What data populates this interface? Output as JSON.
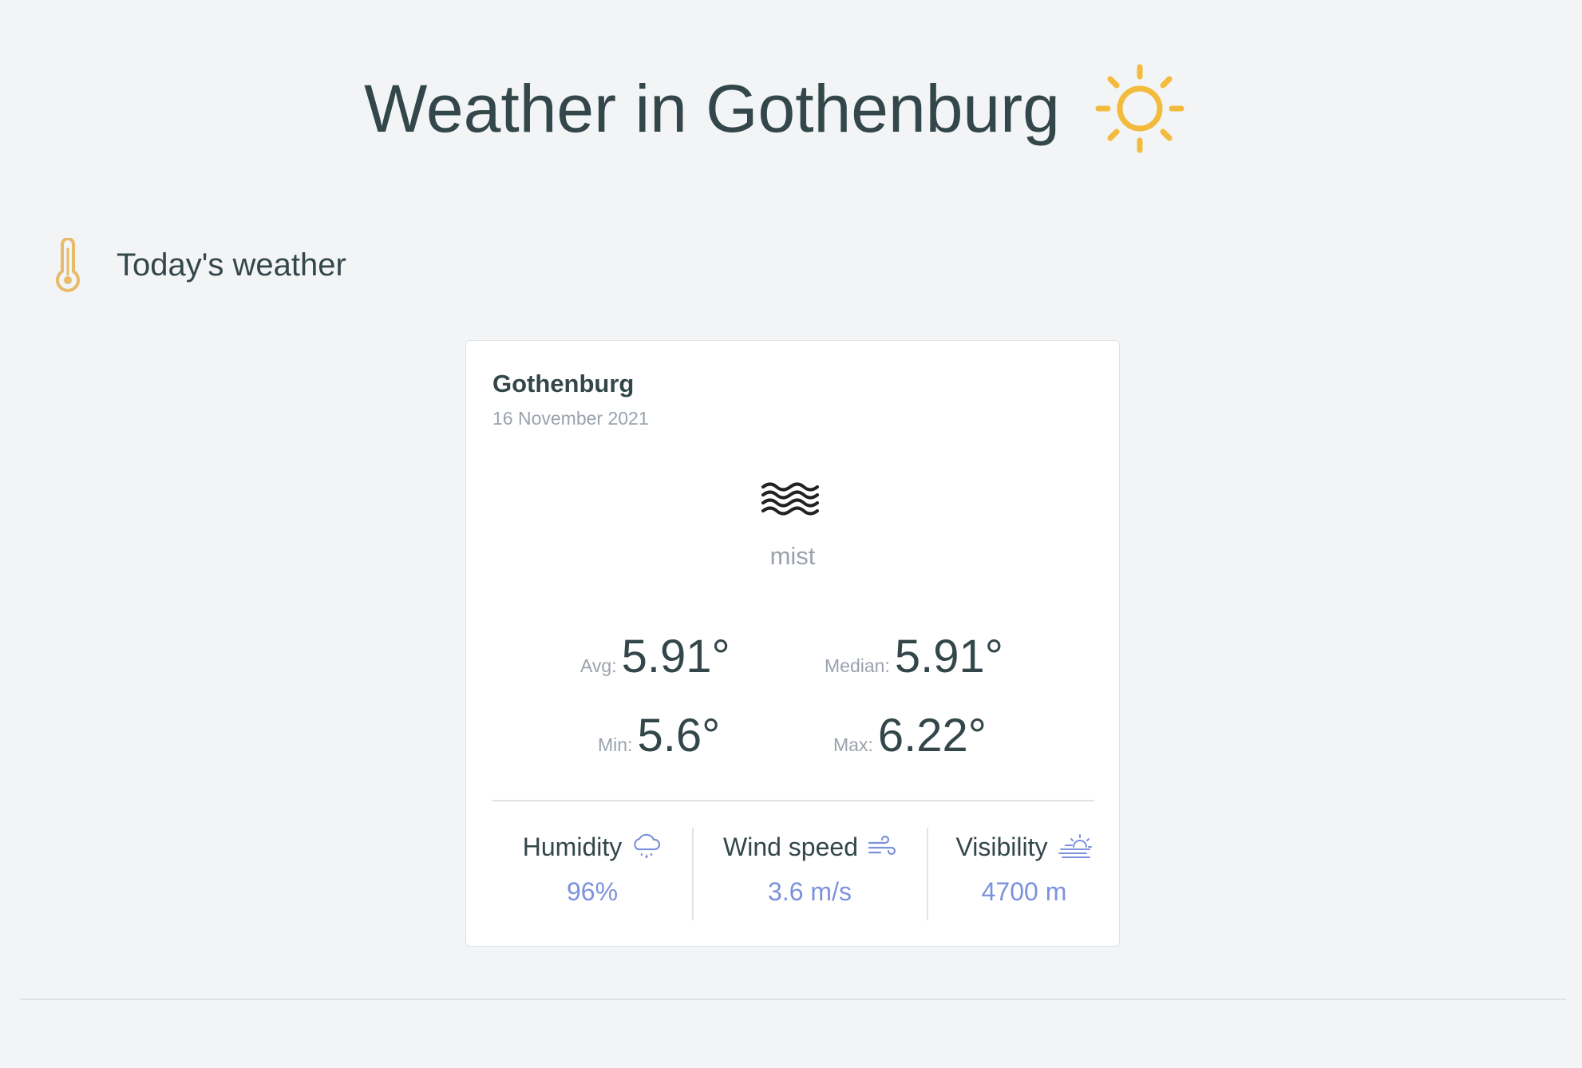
{
  "page": {
    "title": "Weather in Gothenburg",
    "title_icon": "sun-icon"
  },
  "section": {
    "title": "Today's weather",
    "icon": "thermometer-icon"
  },
  "card": {
    "city": "Gothenburg",
    "date": "16 November 2021",
    "condition_icon": "mist-icon",
    "condition": "mist",
    "temperatures": {
      "avg_label": "Avg:",
      "avg_value": "5.91°",
      "median_label": "Median:",
      "median_value": "5.91°",
      "min_label": "Min:",
      "min_value": "5.6°",
      "max_label": "Max:",
      "max_value": "6.22°"
    },
    "stats": [
      {
        "label": "Humidity",
        "icon": "humidity-icon",
        "value": "96%"
      },
      {
        "label": "Wind speed",
        "icon": "wind-icon",
        "value": "3.6 m/s"
      },
      {
        "label": "Visibility",
        "icon": "visibility-icon",
        "value": "4700 m"
      }
    ]
  },
  "colors": {
    "background": "#f3f4f6",
    "text": "#33474a",
    "muted": "#9aa3ad",
    "accent": "#7c92dc",
    "sun": "#f2bb3c",
    "thermometer": "#e8bb6a"
  }
}
